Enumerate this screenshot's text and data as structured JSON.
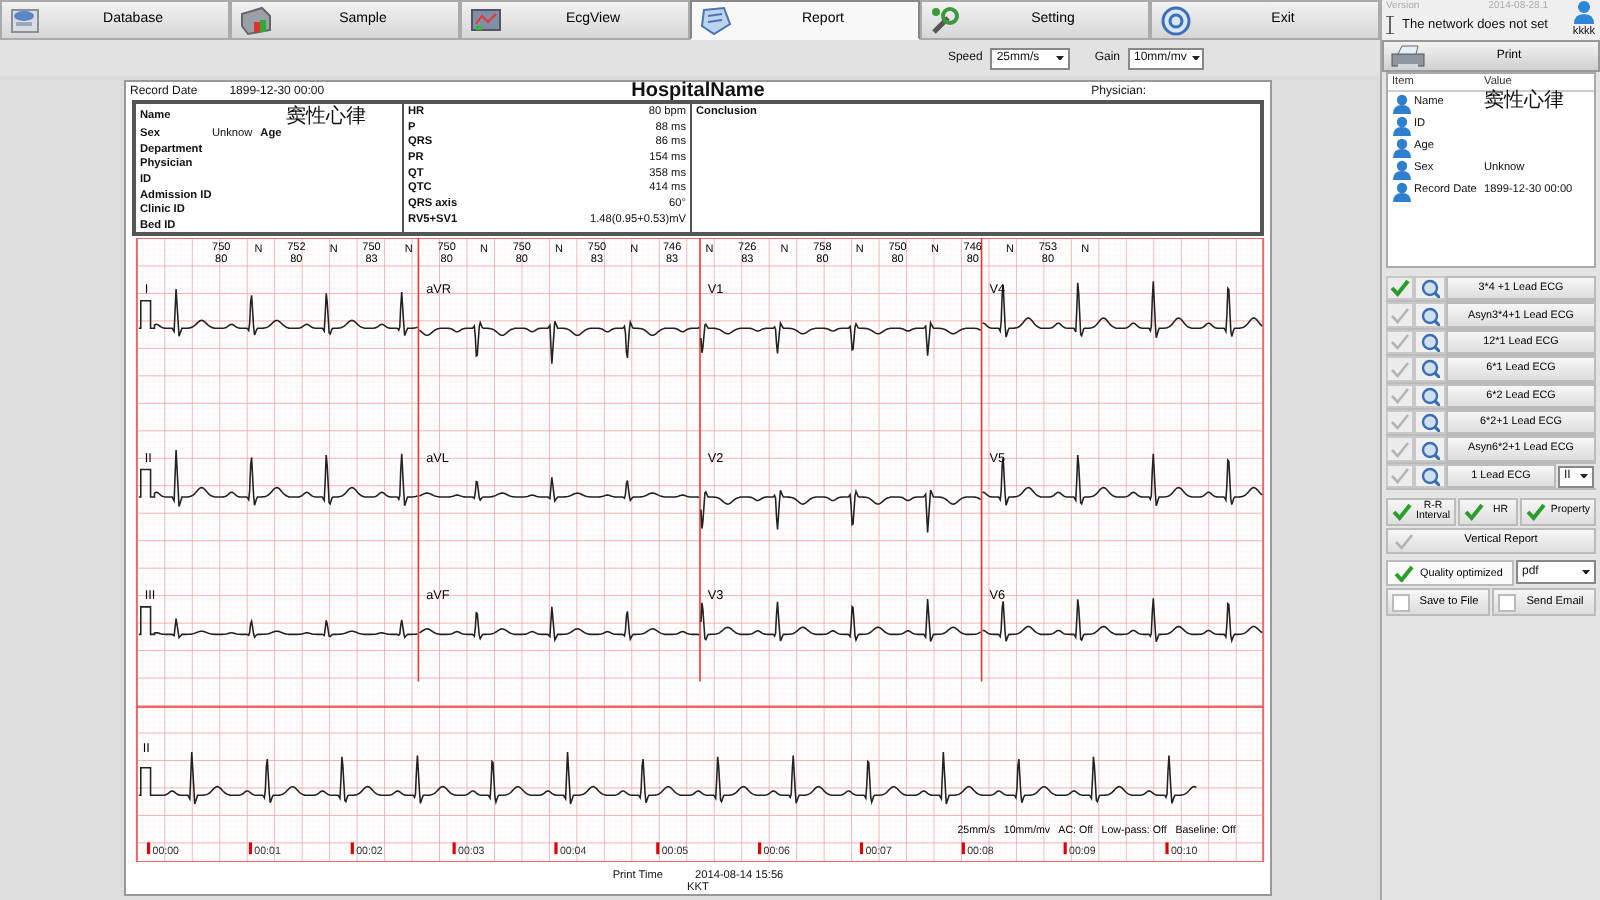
{
  "toolbar": {
    "tabs": [
      {
        "label": "Database",
        "selected": false
      },
      {
        "label": "Sample",
        "selected": false
      },
      {
        "label": "EcgView",
        "selected": false
      },
      {
        "label": "Report",
        "selected": true
      },
      {
        "label": "Setting",
        "selected": false
      },
      {
        "label": "Exit",
        "selected": false
      }
    ],
    "version_label": "Version",
    "version": "2014-08-28.1",
    "network_status": "The network does not set",
    "user": "kkkk"
  },
  "controls": {
    "speed_label": "Speed",
    "speed": "25mm/s",
    "gain_label": "Gain",
    "gain": "10mm/mv"
  },
  "report": {
    "record_date_label": "Record Date",
    "record_date": "1899-12-30 00:00",
    "hospital": "HospitalName",
    "physician_label": "Physician:",
    "patient": [
      {
        "kind": "wide",
        "label": "Name",
        "value": "窦性心律"
      },
      {
        "kind": "pair",
        "label": "Sex",
        "value": "Unknow",
        "aside_label": "Age"
      },
      {
        "kind": "plain",
        "label": "Department"
      },
      {
        "kind": "plain",
        "label": "Physician"
      },
      {
        "kind": "plain",
        "label": "ID"
      },
      {
        "kind": "plain",
        "label": "Admission ID"
      },
      {
        "kind": "plain",
        "label": "Clinic ID"
      },
      {
        "kind": "plain",
        "label": "Bed ID"
      }
    ],
    "measurements": [
      {
        "label": "HR",
        "value": "80 bpm"
      },
      {
        "label": "P",
        "value": "88 ms"
      },
      {
        "label": "QRS",
        "value": "86 ms"
      },
      {
        "label": "PR",
        "value": "154 ms"
      },
      {
        "label": "QT",
        "value": "358 ms"
      },
      {
        "label": "QTC",
        "value": "414 ms"
      },
      {
        "label": "QRS axis",
        "value": "60°"
      },
      {
        "label": "RV5+SV1",
        "value": "1.48(0.95+0.53)mV"
      }
    ],
    "conclusion_label": "Conclusion",
    "beats": [
      {
        "rr": "750",
        "hr": "80",
        "type": "N"
      },
      {
        "rr": "752",
        "hr": "80",
        "type": "N"
      },
      {
        "rr": "750",
        "hr": "83",
        "type": "N"
      },
      {
        "rr": "750",
        "hr": "80",
        "type": "N"
      },
      {
        "rr": "750",
        "hr": "80",
        "type": "N"
      },
      {
        "rr": "750",
        "hr": "83",
        "type": "N"
      },
      {
        "rr": "746",
        "hr": "83",
        "type": "N"
      },
      {
        "rr": "726",
        "hr": "83",
        "type": "N"
      },
      {
        "rr": "758",
        "hr": "80",
        "type": "N"
      },
      {
        "rr": "750",
        "hr": "80",
        "type": "N"
      },
      {
        "rr": "746",
        "hr": "80",
        "type": "N"
      },
      {
        "rr": "753",
        "hr": "80",
        "type": "N"
      }
    ],
    "lead_rows": [
      [
        "I",
        "aVR",
        "V1",
        "V4"
      ],
      [
        "II",
        "aVL",
        "V2",
        "V5"
      ],
      [
        "III",
        "aVF",
        "V3",
        "V6"
      ]
    ],
    "rhythm_lead": "II",
    "filter_status": [
      "25mm/s",
      "10mm/mv",
      "AC: Off",
      "Low-pass: Off",
      "Baseline: Off"
    ],
    "times": [
      "00:00",
      "00:01",
      "00:02",
      "00:03",
      "00:04",
      "00:05",
      "00:06",
      "00:07",
      "00:08",
      "00:09",
      "00:10"
    ],
    "print_time_label": "Print Time",
    "print_time": "2014-08-14 15:56",
    "operator": "KKT"
  },
  "sidebar": {
    "print": "Print",
    "table": {
      "columns": [
        "Item",
        "Value"
      ],
      "rows": [
        {
          "item": "Name",
          "value": "窦性心律"
        },
        {
          "item": "ID"
        },
        {
          "item": "Age"
        },
        {
          "item": "Sex",
          "value": "Unknow"
        },
        {
          "item": "Record Date",
          "value": "1899-12-30 00:00"
        }
      ]
    },
    "report_types": [
      {
        "kind": "plain",
        "label": "3*4 +1 Lead ECG",
        "checked": true
      },
      {
        "kind": "plain",
        "label": "Asyn3*4+1 Lead ECG",
        "checked": false
      },
      {
        "kind": "plain",
        "label": "12*1 Lead ECG",
        "checked": false
      },
      {
        "kind": "plain",
        "label": "6*1 Lead ECG",
        "checked": false
      },
      {
        "kind": "plain",
        "label": "6*2 Lead ECG",
        "checked": false
      },
      {
        "kind": "plain",
        "label": "6*2+1 Lead ECG",
        "checked": false
      },
      {
        "kind": "plain",
        "label": "Asyn6*2+1 Lead ECG",
        "checked": false
      },
      {
        "kind": "select",
        "label": "1 Lead ECG",
        "checked": false,
        "lead": "II"
      }
    ],
    "options": [
      {
        "label": "R-R Interval",
        "checked": true
      },
      {
        "label": "HR",
        "checked": true
      },
      {
        "label": "Property",
        "checked": true
      }
    ],
    "vertical_report": {
      "label": "Vertical Report",
      "checked": false
    },
    "quality": {
      "label": "Quality optimized",
      "checked": true,
      "format": "pdf"
    },
    "buttons": [
      "Save to File",
      "Send Email"
    ]
  }
}
